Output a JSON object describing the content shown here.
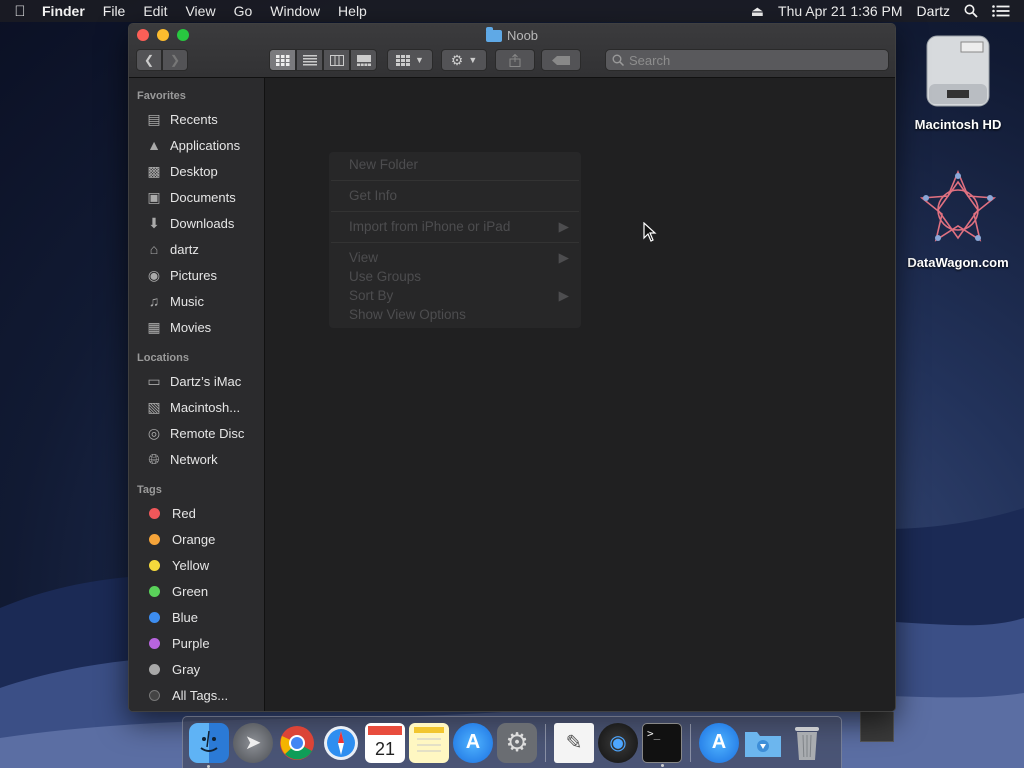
{
  "menubar": {
    "app": "Finder",
    "items": [
      "File",
      "Edit",
      "View",
      "Go",
      "Window",
      "Help"
    ],
    "datetime": "Thu Apr 21  1:36 PM",
    "user": "Dartz"
  },
  "window": {
    "title": "Noob",
    "search_placeholder": "Search"
  },
  "sidebar": {
    "favorites_title": "Favorites",
    "favorites": [
      {
        "label": "Recents",
        "icon": "recents-icon"
      },
      {
        "label": "Applications",
        "icon": "applications-icon"
      },
      {
        "label": "Desktop",
        "icon": "desktop-icon"
      },
      {
        "label": "Documents",
        "icon": "documents-icon"
      },
      {
        "label": "Downloads",
        "icon": "downloads-icon"
      },
      {
        "label": "dartz",
        "icon": "home-icon"
      },
      {
        "label": "Pictures",
        "icon": "camera-icon"
      },
      {
        "label": "Music",
        "icon": "music-note-icon"
      },
      {
        "label": "Movies",
        "icon": "film-icon"
      }
    ],
    "locations_title": "Locations",
    "locations": [
      {
        "label": "Dartz’s iMac",
        "icon": "imac-icon"
      },
      {
        "label": "Macintosh...",
        "icon": "hard-drive-icon"
      },
      {
        "label": "Remote Disc",
        "icon": "disc-icon"
      },
      {
        "label": "Network",
        "icon": "globe-icon"
      }
    ],
    "tags_title": "Tags",
    "tags": [
      {
        "label": "Red",
        "color": "#f0575a"
      },
      {
        "label": "Orange",
        "color": "#f5a43a"
      },
      {
        "label": "Yellow",
        "color": "#f5d93c"
      },
      {
        "label": "Green",
        "color": "#5ad25a"
      },
      {
        "label": "Blue",
        "color": "#3d8df0"
      },
      {
        "label": "Purple",
        "color": "#b864de"
      },
      {
        "label": "Gray",
        "color": "#a8a8a8"
      },
      {
        "label": "All Tags...",
        "color": "#555555"
      }
    ]
  },
  "context_menu": {
    "new_folder": "New Folder",
    "get_info": "Get Info",
    "import": "Import from iPhone or iPad",
    "view": "View",
    "use_groups": "Use Groups",
    "sort_by": "Sort By",
    "show_view_options": "Show View Options"
  },
  "desktop": {
    "hd_label": "Macintosh HD",
    "datawagon_label": "DataWagon.com"
  }
}
